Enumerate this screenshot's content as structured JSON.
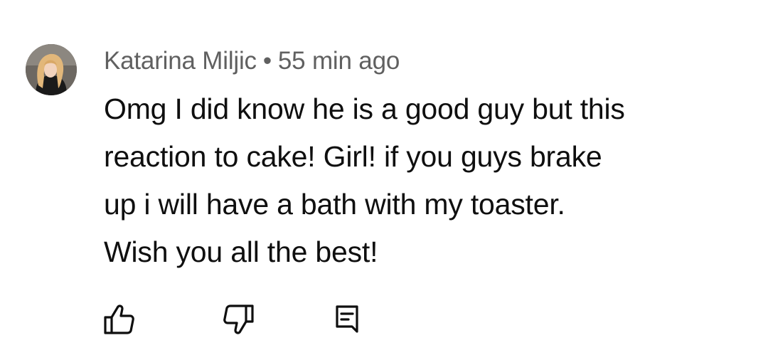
{
  "comment": {
    "author": "Katarina Miljic",
    "separator": "•",
    "time": "55 min ago",
    "lines": [
      "Omg I did know he is a good guy but this",
      "reaction to cake! Girl! if you guys brake",
      "up i will have a bath with my toaster.",
      "Wish you all the best!"
    ]
  },
  "actions": {
    "like_icon": "thumbs-up-icon",
    "dislike_icon": "thumbs-down-icon",
    "reply_icon": "reply-comment-icon"
  },
  "colors": {
    "author_meta": "#606060",
    "text": "#0f0f0f",
    "background": "#ffffff"
  }
}
